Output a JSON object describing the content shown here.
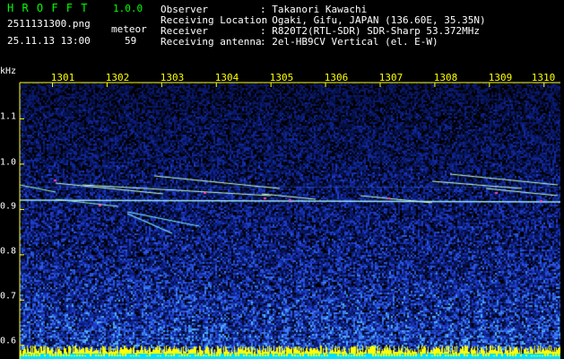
{
  "header": {
    "app_name": "H R O F F T",
    "version": "1.0.0",
    "filename": "2511131300.png",
    "datetime": "25.11.13 13:00",
    "mode_label": "meteor",
    "count": "59",
    "info": [
      {
        "label": "Observer",
        "value": ": Takanori Kawachi"
      },
      {
        "label": "Receiving Location",
        "value": ": Ogaki, Gifu, JAPAN (136.60E, 35.35N)"
      },
      {
        "label": "Receiver",
        "value": ": R820T2(RTL-SDR) SDR-Sharp 53.372MHz"
      },
      {
        "label": "Receiving antenna",
        "value": ": 2el-HB9CV Vertical (el. E-W)"
      }
    ]
  },
  "spectrogram": {
    "y_unit": "kHz",
    "x_ticks": [
      "1301",
      "1302",
      "1303",
      "1304",
      "1305",
      "1306",
      "1307",
      "1308",
      "1309",
      "1310"
    ],
    "y_ticks": [
      "1.1",
      "1.0",
      "0.9",
      "0.8",
      "0.7",
      "0.6"
    ],
    "y_tick_values": [
      1.1,
      1.0,
      0.9,
      0.8,
      0.7,
      0.6
    ],
    "x_tick_minutes": [
      1,
      2,
      3,
      4,
      5,
      6,
      7,
      8,
      9,
      10
    ],
    "x_range_minutes": [
      0.4,
      10.3
    ],
    "y_range_khz": [
      0.57,
      1.18
    ],
    "colors": {
      "background": "#000000",
      "axis": "#ffff00",
      "noise_low": "#0a1a6e",
      "noise_mid": "#1e3cc8",
      "echo": "#ffffff",
      "peak": "#ff44aa",
      "baseline": "#ffff00"
    }
  }
}
